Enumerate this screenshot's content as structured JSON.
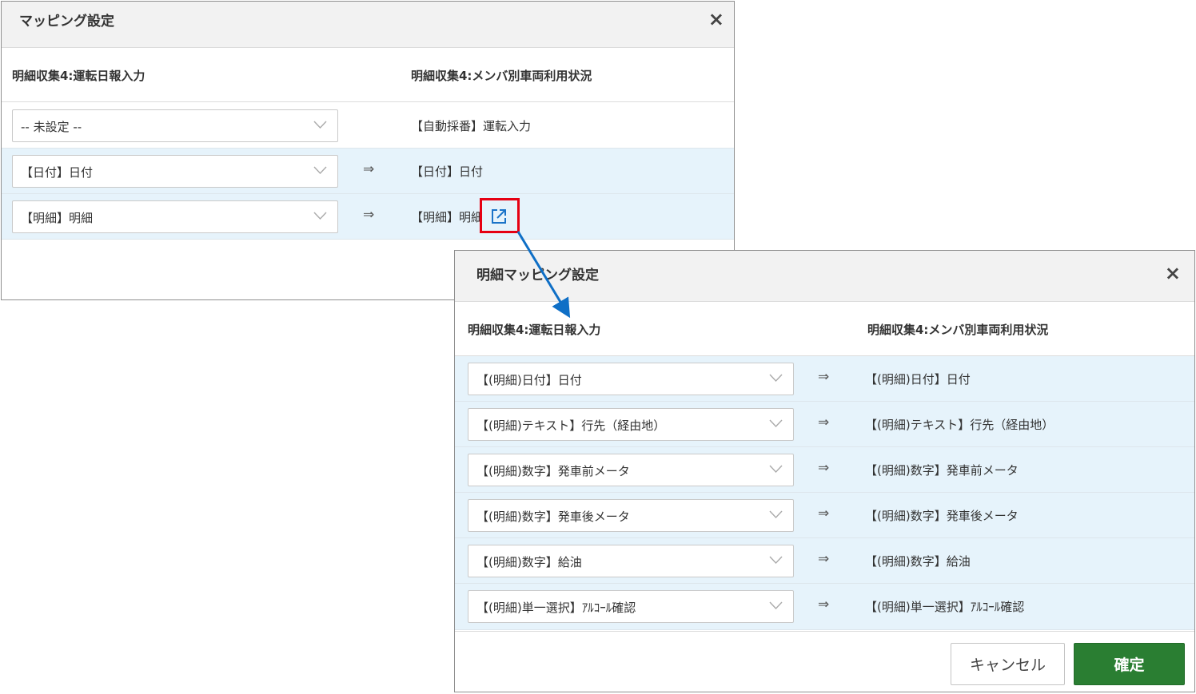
{
  "dialog1": {
    "title": "マッピング設定",
    "close_label": "×",
    "col_source": "明細収集4:運転日報入力",
    "col_target": "明細収集4:メンバ別車両利用状況",
    "rows": [
      {
        "source": "-- 未設定 --",
        "arrow": "",
        "target": "【自動採番】運転入力"
      },
      {
        "source": "【日付】日付",
        "arrow": "⇒",
        "target": "【日付】日付"
      },
      {
        "source": "【明細】明細",
        "arrow": "⇒",
        "target": "【明細】明細"
      }
    ]
  },
  "dialog2": {
    "title": "明細マッピング設定",
    "close_label": "×",
    "col_source": "明細収集4:運転日報入力",
    "col_target": "明細収集4:メンバ別車両利用状況",
    "rows": [
      {
        "source": "【(明細)日付】日付",
        "arrow": "⇒",
        "target": "【(明細)日付】日付"
      },
      {
        "source": "【(明細)テキスト】行先（経由地）",
        "arrow": "⇒",
        "target": "【(明細)テキスト】行先（経由地）"
      },
      {
        "source": "【(明細)数字】発車前メータ",
        "arrow": "⇒",
        "target": "【(明細)数字】発車前メータ"
      },
      {
        "source": "【(明細)数字】発車後メータ",
        "arrow": "⇒",
        "target": "【(明細)数字】発車後メータ"
      },
      {
        "source": "【(明細)数字】給油",
        "arrow": "⇒",
        "target": "【(明細)数字】給油"
      },
      {
        "source": "【(明細)単一選択】ｱﾙｺｰﾙ確認",
        "arrow": "⇒",
        "target": "【(明細)単一選択】ｱﾙｺｰﾙ確認"
      }
    ],
    "cancel_label": "キャンセル",
    "confirm_label": "確定"
  },
  "colors": {
    "highlight": "#e60012",
    "connector": "#0f6fc6",
    "confirm_bg": "#2a7e32",
    "row_shade": "#e6f3fb"
  },
  "icons": {
    "external_link": "external-link-icon",
    "dropdown": "chevron-down-icon",
    "close": "close-icon"
  }
}
